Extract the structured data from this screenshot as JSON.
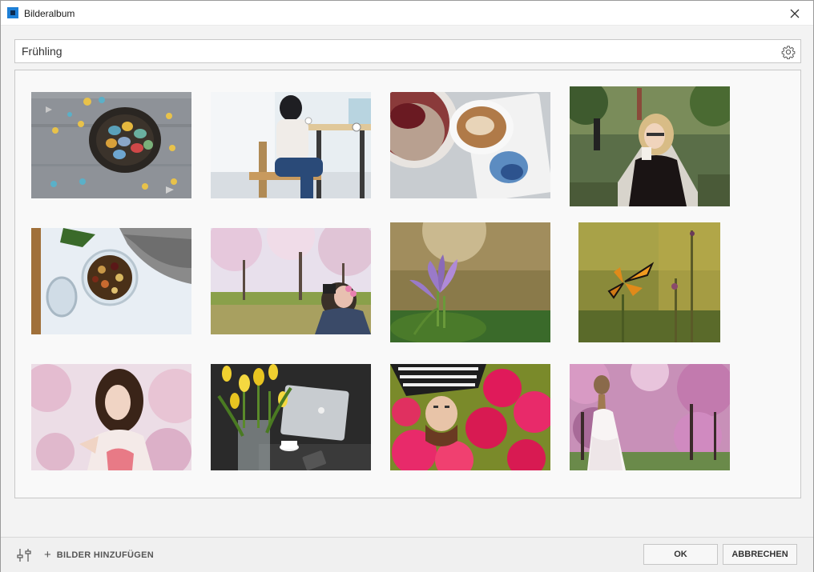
{
  "window": {
    "title": "Bilderalbum"
  },
  "search": {
    "value": "Frühling"
  },
  "icons": {
    "app": "album-app-icon",
    "close": "close-icon",
    "settings": "gear-icon",
    "adjust": "sliders-icon",
    "add": "plus-icon"
  },
  "gallery": {
    "images": [
      {
        "alt": "easter-eggs-nest"
      },
      {
        "alt": "woman-at-cafe"
      },
      {
        "alt": "coffee-and-granola"
      },
      {
        "alt": "woman-drinking-coffee"
      },
      {
        "alt": "jar-of-nuts"
      },
      {
        "alt": "photographer-blossoms"
      },
      {
        "alt": "purple-crocus"
      },
      {
        "alt": "monarch-butterfly"
      },
      {
        "alt": "woman-pink-blossoms"
      },
      {
        "alt": "yellow-tulips-laptop"
      },
      {
        "alt": "woman-lying-in-flowers"
      },
      {
        "alt": "bride-blossom-trees"
      }
    ]
  },
  "footer": {
    "add_images_label": "BILDER HINZUFÜGEN",
    "ok_label": "OK",
    "cancel_label": "ABBRECHEN"
  },
  "colors": {
    "accent": "#1e7fd6",
    "border": "#c8c8c8",
    "background": "#f3f3f3"
  }
}
